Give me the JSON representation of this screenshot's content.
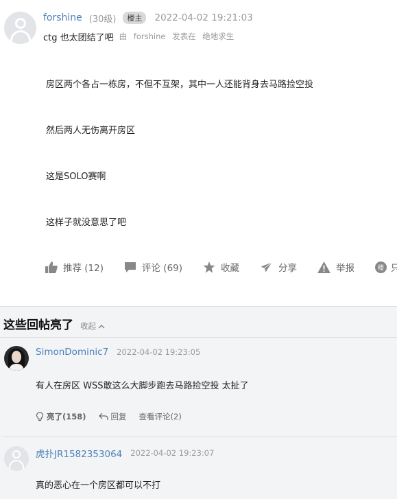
{
  "post": {
    "username": "forshine",
    "level": "(30级)",
    "badge": "楼主",
    "time": "2022-04-02 19:21:03",
    "title": "ctg 也太团结了吧",
    "title_meta": {
      "by": "由",
      "author": "forshine",
      "posted_in": "发表在",
      "board": "绝地求生"
    },
    "paragraphs": [
      "房区两个各占一栋房，不但不互架，其中一人还能背身去马路捡空投",
      "然后两人无伤离开房区",
      "这是SOLO赛啊",
      "这样子就没意思了吧"
    ],
    "actions": {
      "recommend": "推荐 (12)",
      "comment": "评论 (69)",
      "favorite": "收藏",
      "share": "分享",
      "report": "举报",
      "last_icon_char": "楼",
      "last_text": "只"
    }
  },
  "highlights": {
    "title": "这些回帖亮了",
    "collapse": "收起"
  },
  "replies": [
    {
      "username": "SimonDominic7",
      "time": "2022-04-02 19:23:05",
      "text": "有人在房区 WSS敢这么大脚步跑去马路捡空投 太扯了",
      "light": "亮了(158)",
      "reply": "回复",
      "view_comments": "查看评论(2)"
    },
    {
      "username": "虎扑JR1582353064",
      "time": "2022-04-02 19:23:07",
      "text": "真的恶心在一个房区都可以不打"
    }
  ],
  "colors": {
    "link": "#4c80b8",
    "muted": "#999999",
    "section_bg": "#f3f4f6"
  }
}
